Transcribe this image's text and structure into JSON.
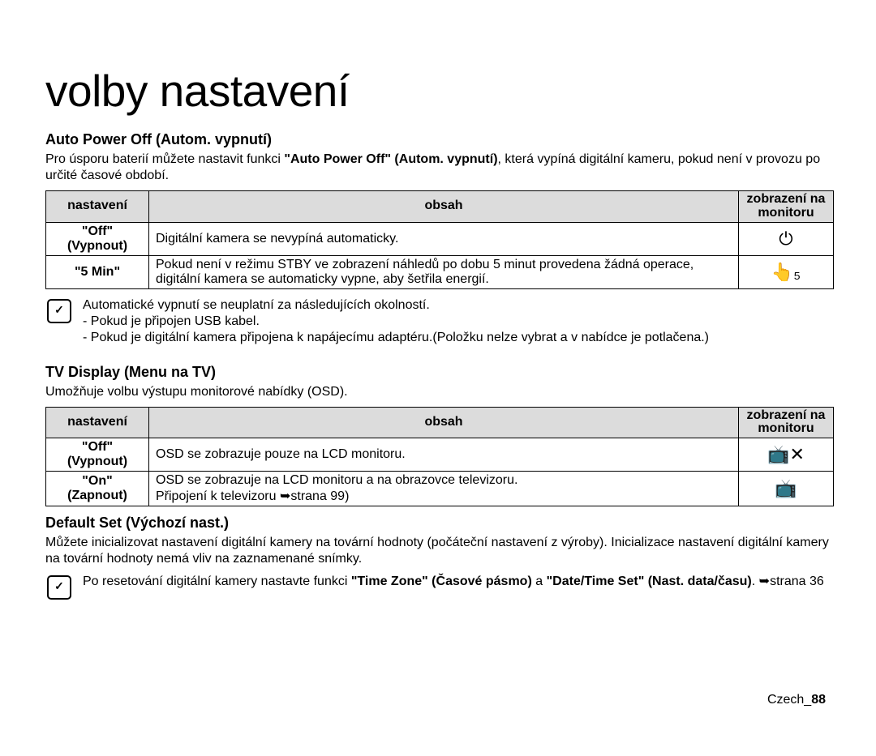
{
  "title": "volby nastavení",
  "section1": {
    "heading": "Auto Power Off (Autom. vypnutí)",
    "para_a": "Pro úsporu baterií můžete nastavit funkci ",
    "para_bold": "\"Auto Power Off\" (Autom. vypnutí)",
    "para_b": ", která vypíná digitální kameru, pokud není v provozu po určité časové období.",
    "th1": "nastavení",
    "th2": "obsah",
    "th3": "zobrazení na monitoru",
    "rows": [
      {
        "setting": "\"Off\" (Vypnout)",
        "desc": "Digitální kamera se nevypíná automaticky.",
        "icon": "⏻"
      },
      {
        "setting": "\"5 Min\"",
        "desc": "Pokud není v režimu STBY ve zobrazení náhledů po dobu 5 minut provedena žádná operace, digitální kamera se automaticky vypne, aby šetřila energií.",
        "icon": "👆₅"
      }
    ],
    "note_lines": "Automatické vypnutí se neuplatní za následujících okolností.\n - Pokud je připojen USB kabel.\n - Pokud je digitální kamera připojena k napájecímu adaptéru.(Položku nelze vybrat a v nabídce je potlačena.)"
  },
  "section2": {
    "heading": "TV Display (Menu na TV)",
    "para": "Umožňuje volbu výstupu monitorové nabídky (OSD).",
    "th1": "nastavení",
    "th2": "obsah",
    "th3": "zobrazení na monitoru",
    "rows": [
      {
        "setting": "\"Off\" (Vypnout)",
        "desc": "OSD se zobrazuje pouze na LCD monitoru.",
        "icon": "📺✕"
      },
      {
        "setting": "\"On\" (Zapnout)",
        "desc": "OSD se zobrazuje na LCD monitoru a na obrazovce televizoru.\nPřipojení k televizoru ➥strana 99)",
        "icon": "📺"
      }
    ]
  },
  "section3": {
    "heading": "Default Set (Výchozí nast.)",
    "para": "Můžete inicializovat nastavení digitální kamery na tovární hodnoty (počáteční nastavení z výroby). Inicializace nastavení digitální kamery na tovární hodnoty nemá vliv na zaznamenané snímky.",
    "note_a": "Po resetování digitální kamery nastavte funkci ",
    "note_b1": "\"Time Zone\" (Časové pásmo)",
    "note_mid": " a ",
    "note_b2": "\"Date/Time Set\" (Nast. data/času)",
    "note_c": ". ➥strana 36"
  },
  "footer": {
    "lang": "Czech",
    "sep": "_",
    "page": "88"
  },
  "icons": {
    "note_badge": "✓"
  }
}
